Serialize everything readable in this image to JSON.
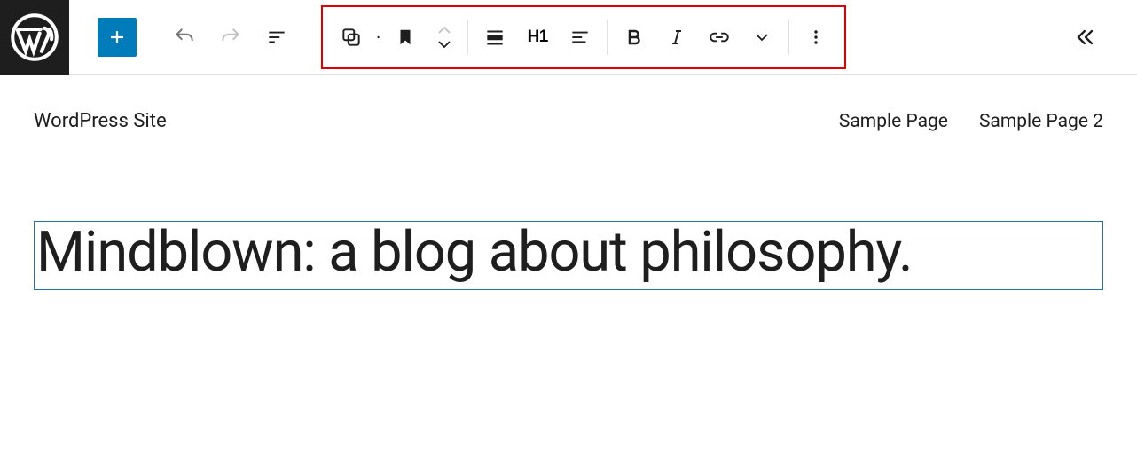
{
  "site": {
    "title": "WordPress Site",
    "nav": [
      {
        "label": "Sample Page"
      },
      {
        "label": "Sample Page 2"
      }
    ]
  },
  "editor": {
    "heading_text": "Mindblown: a blog about philosophy."
  },
  "toolbar": {
    "heading_level_label": "H1"
  }
}
